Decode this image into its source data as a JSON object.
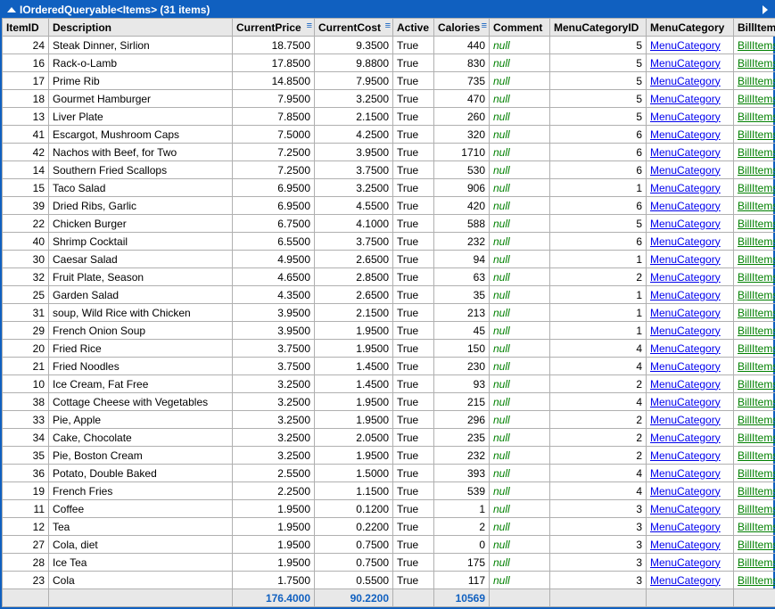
{
  "title": "IOrderedQueryable<Items> (31 items)",
  "columns": [
    "ItemID",
    "Description",
    "CurrentPrice",
    "CurrentCost",
    "Active",
    "Calories",
    "Comment",
    "MenuCategoryID",
    "MenuCategory",
    "BillItems"
  ],
  "sortable_cols": [
    2,
    3,
    5
  ],
  "link_labels": {
    "menu_category": "MenuCategory",
    "bill_items": "BillItems"
  },
  "null_text": "null",
  "rows": [
    {
      "id": 24,
      "desc": "Steak Dinner, Sirlion",
      "price": "18.7500",
      "cost": "9.3500",
      "active": "True",
      "cal": 440,
      "catid": 5
    },
    {
      "id": 16,
      "desc": "Rack-o-Lamb",
      "price": "17.8500",
      "cost": "9.8800",
      "active": "True",
      "cal": 830,
      "catid": 5
    },
    {
      "id": 17,
      "desc": "Prime Rib",
      "price": "14.8500",
      "cost": "7.9500",
      "active": "True",
      "cal": 735,
      "catid": 5
    },
    {
      "id": 18,
      "desc": "Gourmet Hamburger",
      "price": "7.9500",
      "cost": "3.2500",
      "active": "True",
      "cal": 470,
      "catid": 5
    },
    {
      "id": 13,
      "desc": "Liver Plate",
      "price": "7.8500",
      "cost": "2.1500",
      "active": "True",
      "cal": 260,
      "catid": 5
    },
    {
      "id": 41,
      "desc": "Escargot, Mushroom Caps",
      "price": "7.5000",
      "cost": "4.2500",
      "active": "True",
      "cal": 320,
      "catid": 6
    },
    {
      "id": 42,
      "desc": "Nachos with Beef, for Two",
      "price": "7.2500",
      "cost": "3.9500",
      "active": "True",
      "cal": 1710,
      "catid": 6
    },
    {
      "id": 14,
      "desc": "Southern Fried Scallops",
      "price": "7.2500",
      "cost": "3.7500",
      "active": "True",
      "cal": 530,
      "catid": 6
    },
    {
      "id": 15,
      "desc": "Taco Salad",
      "price": "6.9500",
      "cost": "3.2500",
      "active": "True",
      "cal": 906,
      "catid": 1
    },
    {
      "id": 39,
      "desc": "Dried Ribs, Garlic",
      "price": "6.9500",
      "cost": "4.5500",
      "active": "True",
      "cal": 420,
      "catid": 6
    },
    {
      "id": 22,
      "desc": "Chicken Burger",
      "price": "6.7500",
      "cost": "4.1000",
      "active": "True",
      "cal": 588,
      "catid": 5
    },
    {
      "id": 40,
      "desc": "Shrimp Cocktail",
      "price": "6.5500",
      "cost": "3.7500",
      "active": "True",
      "cal": 232,
      "catid": 6
    },
    {
      "id": 30,
      "desc": "Caesar Salad",
      "price": "4.9500",
      "cost": "2.6500",
      "active": "True",
      "cal": 94,
      "catid": 1
    },
    {
      "id": 32,
      "desc": "Fruit Plate, Season",
      "price": "4.6500",
      "cost": "2.8500",
      "active": "True",
      "cal": 63,
      "catid": 2
    },
    {
      "id": 25,
      "desc": "Garden Salad",
      "price": "4.3500",
      "cost": "2.6500",
      "active": "True",
      "cal": 35,
      "catid": 1
    },
    {
      "id": 31,
      "desc": "soup, Wild Rice with Chicken",
      "price": "3.9500",
      "cost": "2.1500",
      "active": "True",
      "cal": 213,
      "catid": 1
    },
    {
      "id": 29,
      "desc": "French Onion Soup",
      "price": "3.9500",
      "cost": "1.9500",
      "active": "True",
      "cal": 45,
      "catid": 1
    },
    {
      "id": 20,
      "desc": "Fried Rice",
      "price": "3.7500",
      "cost": "1.9500",
      "active": "True",
      "cal": 150,
      "catid": 4
    },
    {
      "id": 21,
      "desc": "Fried Noodles",
      "price": "3.7500",
      "cost": "1.4500",
      "active": "True",
      "cal": 230,
      "catid": 4
    },
    {
      "id": 10,
      "desc": "Ice Cream, Fat Free",
      "price": "3.2500",
      "cost": "1.4500",
      "active": "True",
      "cal": 93,
      "catid": 2
    },
    {
      "id": 38,
      "desc": "Cottage Cheese with Vegetables",
      "price": "3.2500",
      "cost": "1.9500",
      "active": "True",
      "cal": 215,
      "catid": 4
    },
    {
      "id": 33,
      "desc": "Pie, Apple",
      "price": "3.2500",
      "cost": "1.9500",
      "active": "True",
      "cal": 296,
      "catid": 2
    },
    {
      "id": 34,
      "desc": "Cake, Chocolate",
      "price": "3.2500",
      "cost": "2.0500",
      "active": "True",
      "cal": 235,
      "catid": 2
    },
    {
      "id": 35,
      "desc": "Pie, Boston Cream",
      "price": "3.2500",
      "cost": "1.9500",
      "active": "True",
      "cal": 232,
      "catid": 2
    },
    {
      "id": 36,
      "desc": "Potato, Double Baked",
      "price": "2.5500",
      "cost": "1.5000",
      "active": "True",
      "cal": 393,
      "catid": 4
    },
    {
      "id": 19,
      "desc": "French Fries",
      "price": "2.2500",
      "cost": "1.1500",
      "active": "True",
      "cal": 539,
      "catid": 4
    },
    {
      "id": 11,
      "desc": "Coffee",
      "price": "1.9500",
      "cost": "0.1200",
      "active": "True",
      "cal": 1,
      "catid": 3
    },
    {
      "id": 12,
      "desc": "Tea",
      "price": "1.9500",
      "cost": "0.2200",
      "active": "True",
      "cal": 2,
      "catid": 3
    },
    {
      "id": 27,
      "desc": "Cola, diet",
      "price": "1.9500",
      "cost": "0.7500",
      "active": "True",
      "cal": 0,
      "catid": 3
    },
    {
      "id": 28,
      "desc": "Ice Tea",
      "price": "1.9500",
      "cost": "0.7500",
      "active": "True",
      "cal": 175,
      "catid": 3
    },
    {
      "id": 23,
      "desc": "Cola",
      "price": "1.7500",
      "cost": "0.5500",
      "active": "True",
      "cal": 117,
      "catid": 3
    }
  ],
  "footer": {
    "price": "176.4000",
    "cost": "90.2200",
    "cal": "10569"
  }
}
